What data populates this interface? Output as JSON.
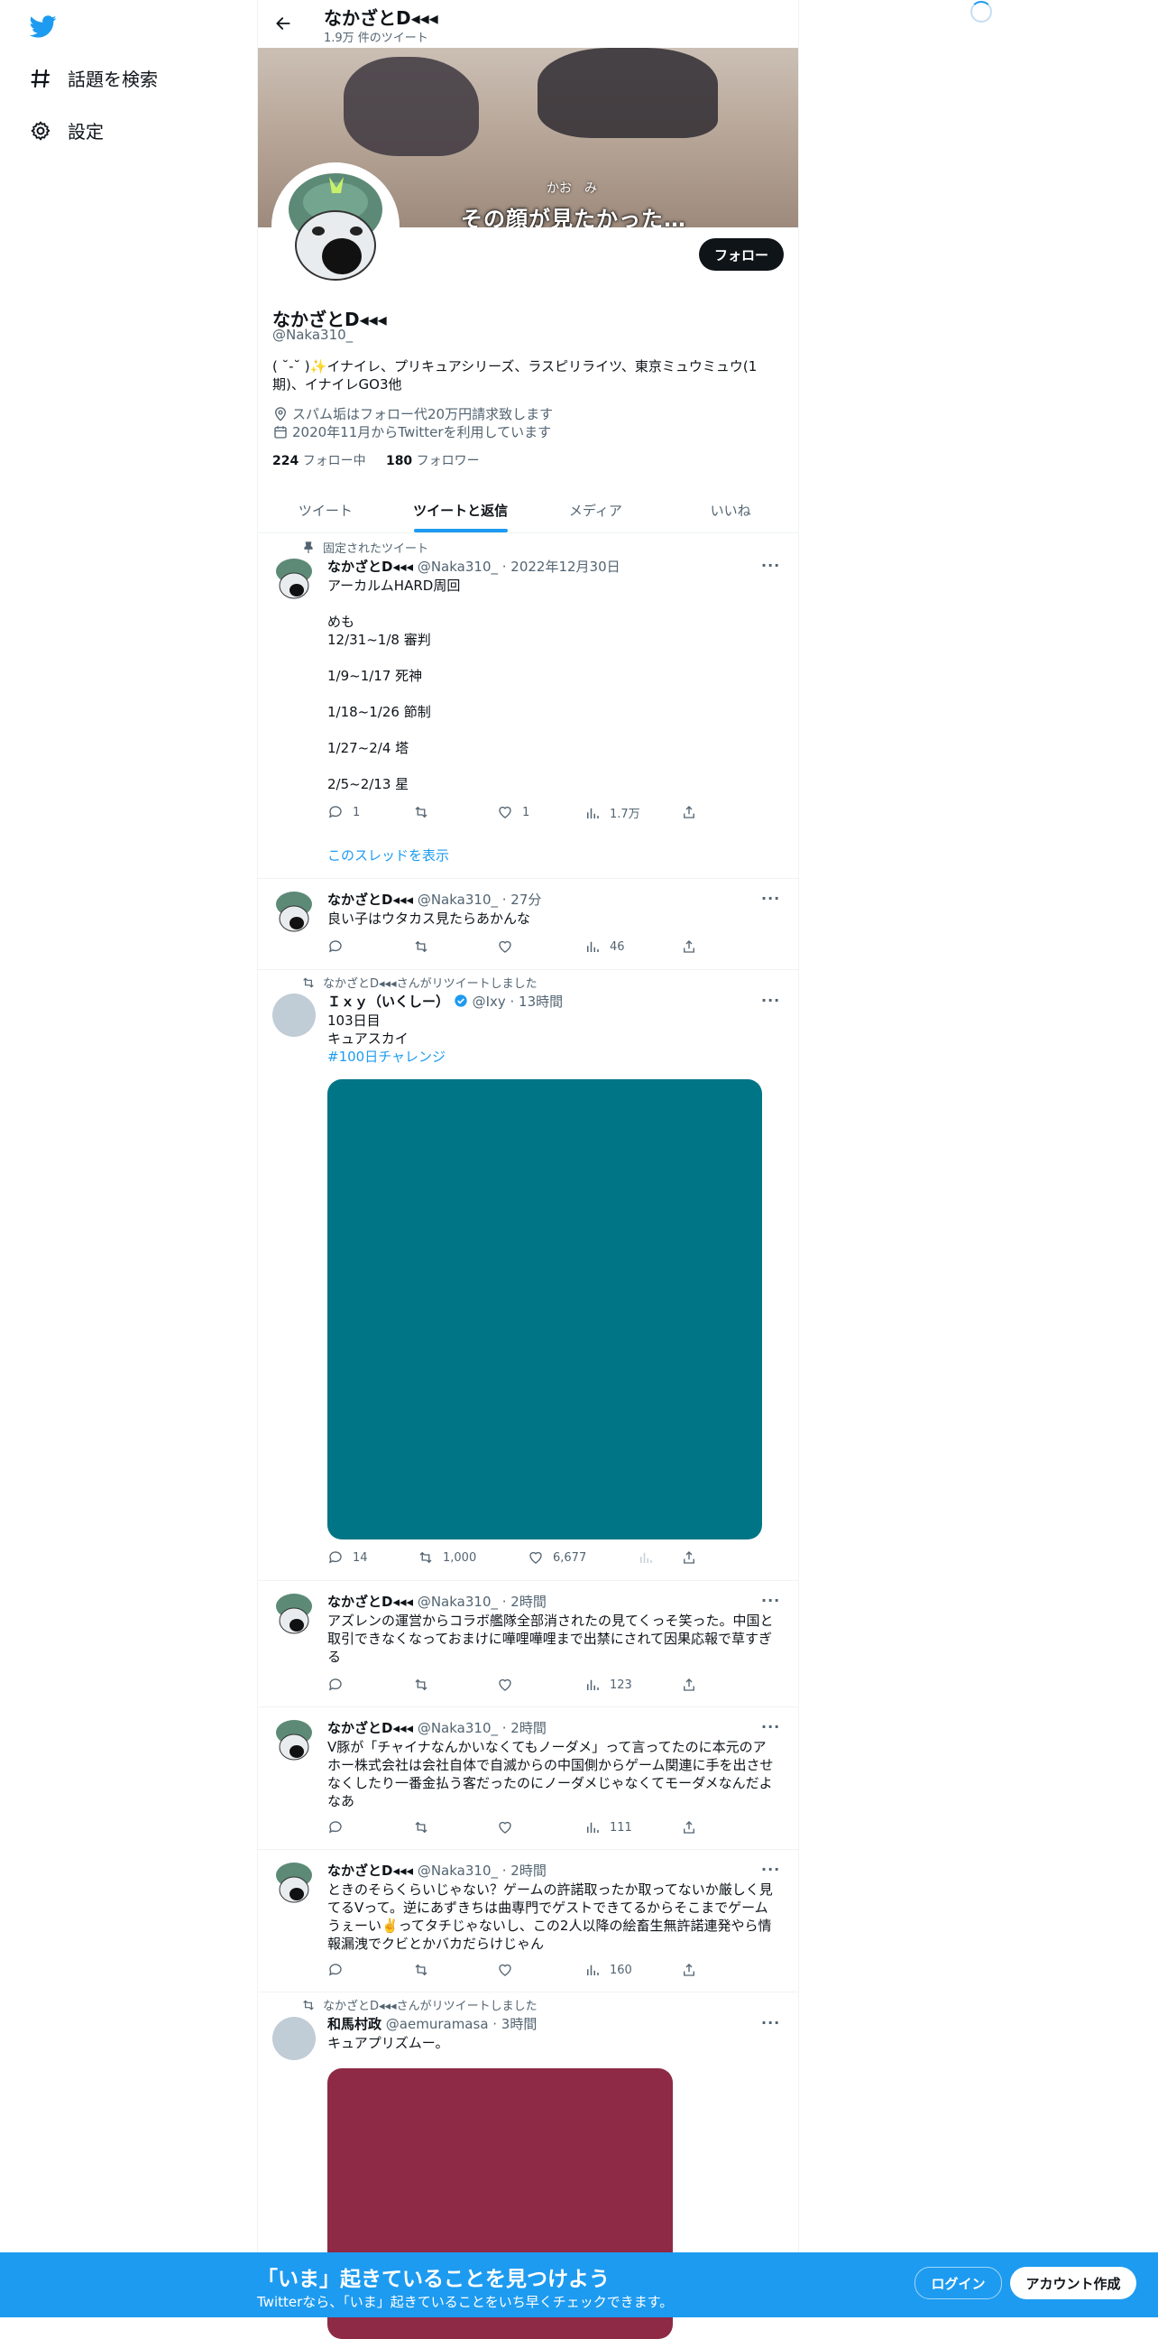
{
  "nav": {
    "explore_label": "話題を検索",
    "settings_label": "設定"
  },
  "header": {
    "name": "なかざとD◂◂◂",
    "tweet_count": "1.9万 件のツイート"
  },
  "banner": {
    "subtitle": "その顔が見たかった…",
    "small_text": "かお　み"
  },
  "profile": {
    "name": "なかざとD◂◂◂",
    "handle": "@Naka310_",
    "bio": "( ˘-˘ )✨イナイレ、プリキュアシリーズ、ラスピリライツ、東京ミュウミュウ(1期)、イナイレGO3他",
    "location": "スパム垢はフォロー代20万円請求致します",
    "joined": "2020年11月からTwitterを利用しています",
    "following_count": "224",
    "following_label": "フォロー中",
    "followers_count": "180",
    "followers_label": "フォロワー",
    "follow_button": "フォロー"
  },
  "tabs": [
    {
      "label": "ツイート"
    },
    {
      "label": "ツイートと返信"
    },
    {
      "label": "メディア"
    },
    {
      "label": "いいね"
    }
  ],
  "tweets": [
    {
      "social_context": "固定されたツイート",
      "name": "なかざとD◂◂◂",
      "meta": "@Naka310_ · 2022年12月30日",
      "text": "アーカルムHARD周回\n\nめも\n12/31~1/8 審判\n\n1/9~1/17 死神\n\n1/18~1/26 節制\n\n1/27~2/4 塔\n\n2/5~2/13 星",
      "replies": "1",
      "retweets": "",
      "likes": "1",
      "views": "1.7万",
      "thread_link": "このスレッドを表示"
    },
    {
      "name": "なかざとD◂◂◂",
      "meta": "@Naka310_ · 27分",
      "text": "良い子はウタカス見たらあかんな",
      "replies": "",
      "retweets": "",
      "likes": "",
      "views": "46"
    },
    {
      "social_context": "なかざとD◂◂◂さんがリツイートしました",
      "name": "Ｉｘｙ（いくしー）",
      "meta": "@Ixy · 13時間",
      "text": "103日目\nキュアスカイ",
      "hashtag": "#100日チャレンジ",
      "media_color": "#007586",
      "replies": "14",
      "retweets": "1,000",
      "likes": "6,677",
      "views": ""
    },
    {
      "name": "なかざとD◂◂◂",
      "meta": "@Naka310_ · 2時間",
      "text": "アズレンの運営からコラボ艦隊全部消されたの見てくっそ笑った。中国と取引できなくなっておまけに嘩哩嘩哩まで出禁にされて因果応報で草すぎる",
      "replies": "",
      "retweets": "",
      "likes": "",
      "views": "123"
    },
    {
      "name": "なかざとD◂◂◂",
      "meta": "@Naka310_ · 2時間",
      "text": "V豚が「チャイナなんかいなくてもノーダメ」って言ってたのに本元のアホー株式会社は会社自体で自滅からの中国側からゲーム関連に手を出させなくしたり一番金払う客だったのにノーダメじゃなくてモーダメなんだよなあ",
      "replies": "",
      "retweets": "",
      "likes": "",
      "views": "111"
    },
    {
      "name": "なかざとD◂◂◂",
      "meta": "@Naka310_ · 2時間",
      "text": "ときのそらくらいじゃない？ゲームの許諾取ったか取ってないか厳しく見てるVって。逆にあずきちは曲専門でゲストできてるからそこまでゲームうぇーい✌️ってタチじゃないし、この2人以降の絵畜生無許諾連発やら情報漏洩でクビとかバカだらけじゃん",
      "replies": "",
      "retweets": "",
      "likes": "",
      "views": "160"
    },
    {
      "social_context": "なかざとD◂◂◂さんがリツイートしました",
      "name": "和馬村政",
      "meta": "@aemuramasa · 3時間",
      "text": "キュアプリズムー。",
      "media_color": "#8e2a45"
    }
  ],
  "bottom_bar": {
    "title": "「いま」起きていることを見つけよう",
    "subtitle": "Twitterなら、「いま」起きていることをいち早くチェックできます。",
    "login": "ログイン",
    "signup": "アカウント作成"
  },
  "colors": {
    "accent": "#1d9bf0",
    "banner_bottom": "#1d9bf0"
  }
}
